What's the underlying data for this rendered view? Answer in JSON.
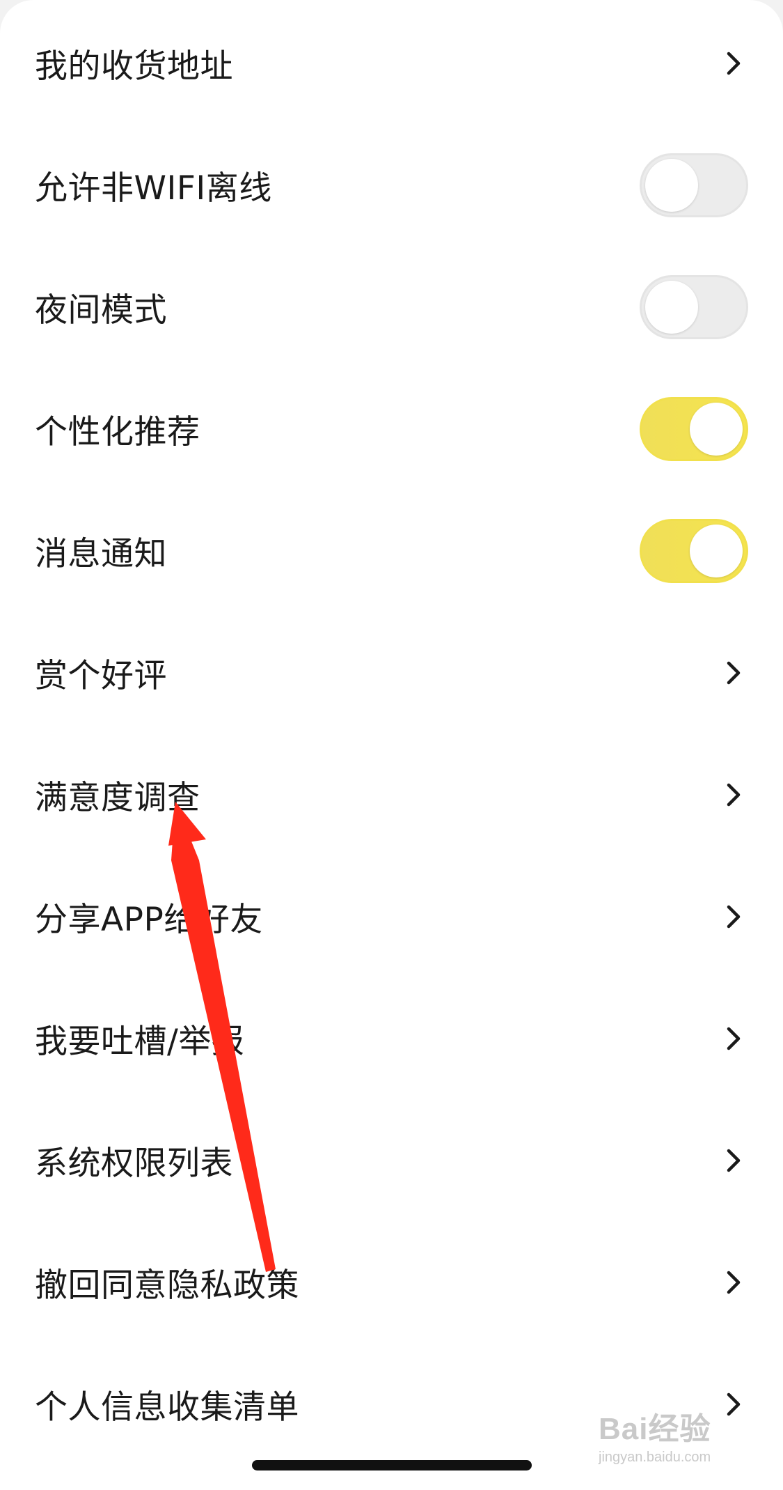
{
  "settings": {
    "items": [
      {
        "label": "我的收货地址",
        "control": "chevron"
      },
      {
        "label": "允许非WIFI离线",
        "control": "toggle",
        "on": false
      },
      {
        "label": "夜间模式",
        "control": "toggle",
        "on": false
      },
      {
        "label": "个性化推荐",
        "control": "toggle",
        "on": true
      },
      {
        "label": "消息通知",
        "control": "toggle",
        "on": true
      },
      {
        "label": "赏个好评",
        "control": "chevron"
      },
      {
        "label": "满意度调查",
        "control": "chevron"
      },
      {
        "label": "分享APP给好友",
        "control": "chevron"
      },
      {
        "label": "我要吐槽/举报",
        "control": "chevron"
      },
      {
        "label": "系统权限列表",
        "control": "chevron"
      },
      {
        "label": "撤回同意隐私政策",
        "control": "chevron"
      },
      {
        "label": "个人信息收集清单",
        "control": "chevron"
      }
    ]
  },
  "watermark": {
    "brand": "Bai经验",
    "url": "jingyan.baidu.com"
  },
  "colors": {
    "toggle_on": "#f3e24f",
    "toggle_off": "#ececec",
    "annotation_arrow": "#ff2a1a"
  },
  "icons": {
    "chevron": "chevron-right-icon",
    "annotation": "red-arrow-annotation"
  }
}
